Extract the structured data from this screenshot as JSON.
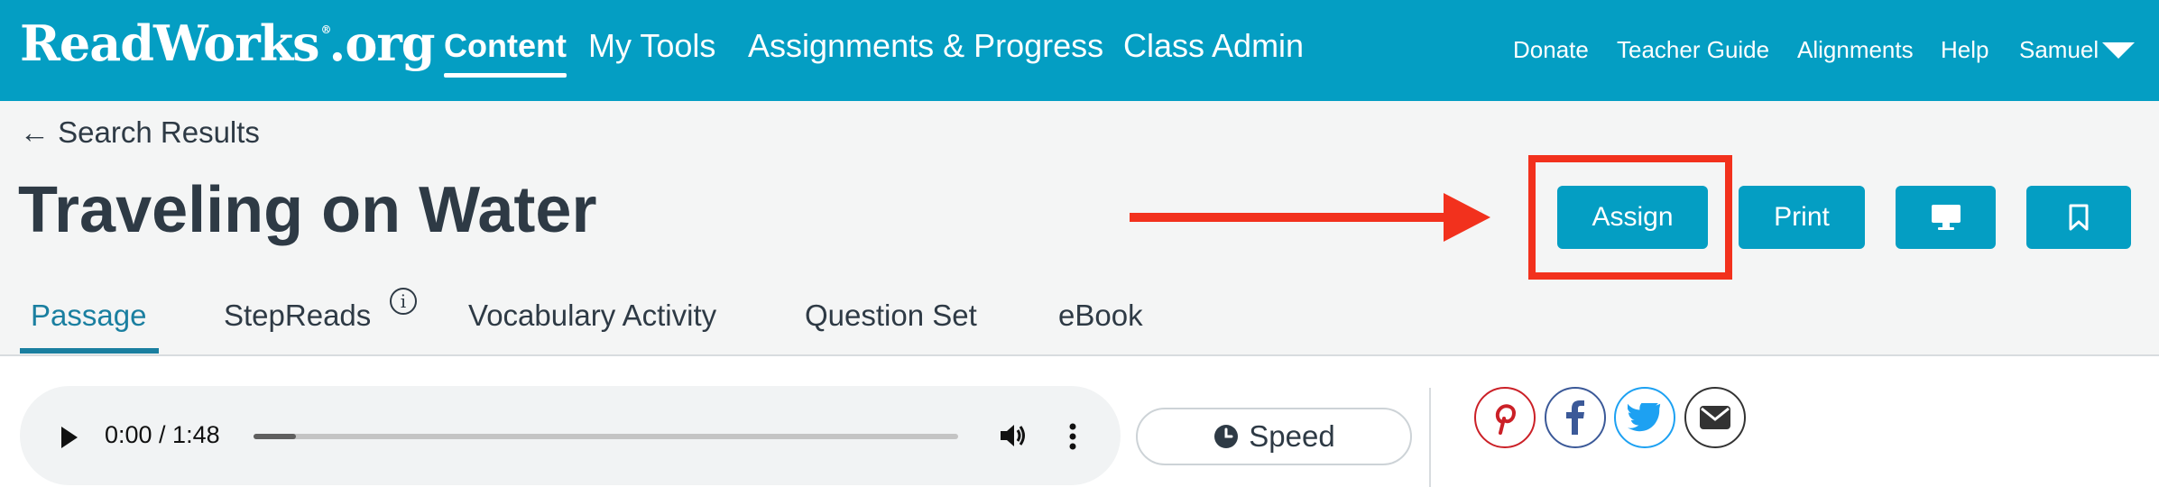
{
  "header": {
    "logo": {
      "name": "ReadWorks",
      "reg": "®",
      "tld": ".org"
    },
    "nav_main": [
      "Content",
      "My Tools",
      "Assignments & Progress",
      "Class Admin"
    ],
    "nav_utility": [
      "Donate",
      "Teacher Guide",
      "Alignments",
      "Help",
      "Samuel"
    ]
  },
  "page": {
    "back_link": "← Search Results",
    "title": "Traveling on Water"
  },
  "actions": {
    "assign_label": "Assign",
    "print_label": "Print",
    "project_icon": "monitor-icon",
    "bookmark_icon": "bookmark-icon"
  },
  "tabs": {
    "items": [
      "Passage",
      "StepReads",
      "Vocabulary Activity",
      "Question Set",
      "eBook"
    ],
    "active": "Passage",
    "info_glyph": "i"
  },
  "audio": {
    "time": "0:00 / 1:48",
    "progress": 0.06
  },
  "speed": {
    "label": "Speed"
  },
  "share": [
    "pinterest-icon",
    "facebook-icon",
    "twitter-icon",
    "email-icon"
  ],
  "colors": {
    "brand": "#049ec3",
    "annotation": "#f2311d",
    "active_tab": "#1a7fa0",
    "pinterest": "#cb2027",
    "facebook": "#3b5998",
    "twitter": "#1da1f2",
    "email": "#333333"
  }
}
